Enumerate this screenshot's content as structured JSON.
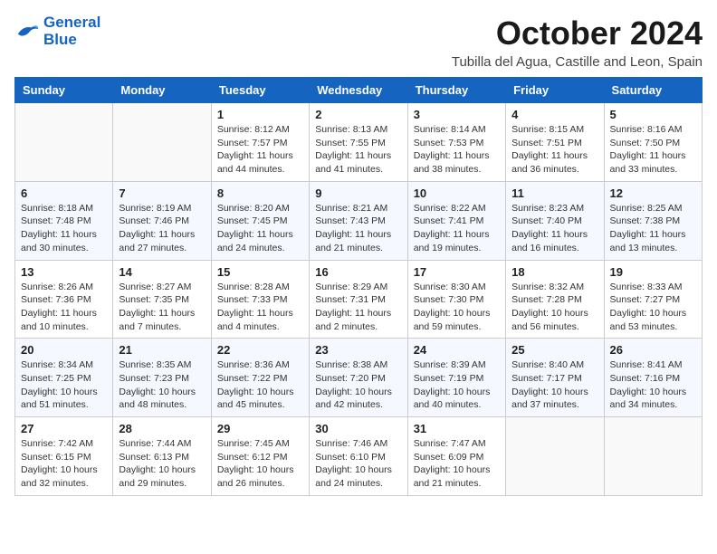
{
  "header": {
    "logo_line1": "General",
    "logo_line2": "Blue",
    "month_title": "October 2024",
    "location": "Tubilla del Agua, Castille and Leon, Spain"
  },
  "days_of_week": [
    "Sunday",
    "Monday",
    "Tuesday",
    "Wednesday",
    "Thursday",
    "Friday",
    "Saturday"
  ],
  "weeks": [
    [
      {
        "day": "",
        "info": ""
      },
      {
        "day": "",
        "info": ""
      },
      {
        "day": "1",
        "info": "Sunrise: 8:12 AM\nSunset: 7:57 PM\nDaylight: 11 hours and 44 minutes."
      },
      {
        "day": "2",
        "info": "Sunrise: 8:13 AM\nSunset: 7:55 PM\nDaylight: 11 hours and 41 minutes."
      },
      {
        "day": "3",
        "info": "Sunrise: 8:14 AM\nSunset: 7:53 PM\nDaylight: 11 hours and 38 minutes."
      },
      {
        "day": "4",
        "info": "Sunrise: 8:15 AM\nSunset: 7:51 PM\nDaylight: 11 hours and 36 minutes."
      },
      {
        "day": "5",
        "info": "Sunrise: 8:16 AM\nSunset: 7:50 PM\nDaylight: 11 hours and 33 minutes."
      }
    ],
    [
      {
        "day": "6",
        "info": "Sunrise: 8:18 AM\nSunset: 7:48 PM\nDaylight: 11 hours and 30 minutes."
      },
      {
        "day": "7",
        "info": "Sunrise: 8:19 AM\nSunset: 7:46 PM\nDaylight: 11 hours and 27 minutes."
      },
      {
        "day": "8",
        "info": "Sunrise: 8:20 AM\nSunset: 7:45 PM\nDaylight: 11 hours and 24 minutes."
      },
      {
        "day": "9",
        "info": "Sunrise: 8:21 AM\nSunset: 7:43 PM\nDaylight: 11 hours and 21 minutes."
      },
      {
        "day": "10",
        "info": "Sunrise: 8:22 AM\nSunset: 7:41 PM\nDaylight: 11 hours and 19 minutes."
      },
      {
        "day": "11",
        "info": "Sunrise: 8:23 AM\nSunset: 7:40 PM\nDaylight: 11 hours and 16 minutes."
      },
      {
        "day": "12",
        "info": "Sunrise: 8:25 AM\nSunset: 7:38 PM\nDaylight: 11 hours and 13 minutes."
      }
    ],
    [
      {
        "day": "13",
        "info": "Sunrise: 8:26 AM\nSunset: 7:36 PM\nDaylight: 11 hours and 10 minutes."
      },
      {
        "day": "14",
        "info": "Sunrise: 8:27 AM\nSunset: 7:35 PM\nDaylight: 11 hours and 7 minutes."
      },
      {
        "day": "15",
        "info": "Sunrise: 8:28 AM\nSunset: 7:33 PM\nDaylight: 11 hours and 4 minutes."
      },
      {
        "day": "16",
        "info": "Sunrise: 8:29 AM\nSunset: 7:31 PM\nDaylight: 11 hours and 2 minutes."
      },
      {
        "day": "17",
        "info": "Sunrise: 8:30 AM\nSunset: 7:30 PM\nDaylight: 10 hours and 59 minutes."
      },
      {
        "day": "18",
        "info": "Sunrise: 8:32 AM\nSunset: 7:28 PM\nDaylight: 10 hours and 56 minutes."
      },
      {
        "day": "19",
        "info": "Sunrise: 8:33 AM\nSunset: 7:27 PM\nDaylight: 10 hours and 53 minutes."
      }
    ],
    [
      {
        "day": "20",
        "info": "Sunrise: 8:34 AM\nSunset: 7:25 PM\nDaylight: 10 hours and 51 minutes."
      },
      {
        "day": "21",
        "info": "Sunrise: 8:35 AM\nSunset: 7:23 PM\nDaylight: 10 hours and 48 minutes."
      },
      {
        "day": "22",
        "info": "Sunrise: 8:36 AM\nSunset: 7:22 PM\nDaylight: 10 hours and 45 minutes."
      },
      {
        "day": "23",
        "info": "Sunrise: 8:38 AM\nSunset: 7:20 PM\nDaylight: 10 hours and 42 minutes."
      },
      {
        "day": "24",
        "info": "Sunrise: 8:39 AM\nSunset: 7:19 PM\nDaylight: 10 hours and 40 minutes."
      },
      {
        "day": "25",
        "info": "Sunrise: 8:40 AM\nSunset: 7:17 PM\nDaylight: 10 hours and 37 minutes."
      },
      {
        "day": "26",
        "info": "Sunrise: 8:41 AM\nSunset: 7:16 PM\nDaylight: 10 hours and 34 minutes."
      }
    ],
    [
      {
        "day": "27",
        "info": "Sunrise: 7:42 AM\nSunset: 6:15 PM\nDaylight: 10 hours and 32 minutes."
      },
      {
        "day": "28",
        "info": "Sunrise: 7:44 AM\nSunset: 6:13 PM\nDaylight: 10 hours and 29 minutes."
      },
      {
        "day": "29",
        "info": "Sunrise: 7:45 AM\nSunset: 6:12 PM\nDaylight: 10 hours and 26 minutes."
      },
      {
        "day": "30",
        "info": "Sunrise: 7:46 AM\nSunset: 6:10 PM\nDaylight: 10 hours and 24 minutes."
      },
      {
        "day": "31",
        "info": "Sunrise: 7:47 AM\nSunset: 6:09 PM\nDaylight: 10 hours and 21 minutes."
      },
      {
        "day": "",
        "info": ""
      },
      {
        "day": "",
        "info": ""
      }
    ]
  ]
}
